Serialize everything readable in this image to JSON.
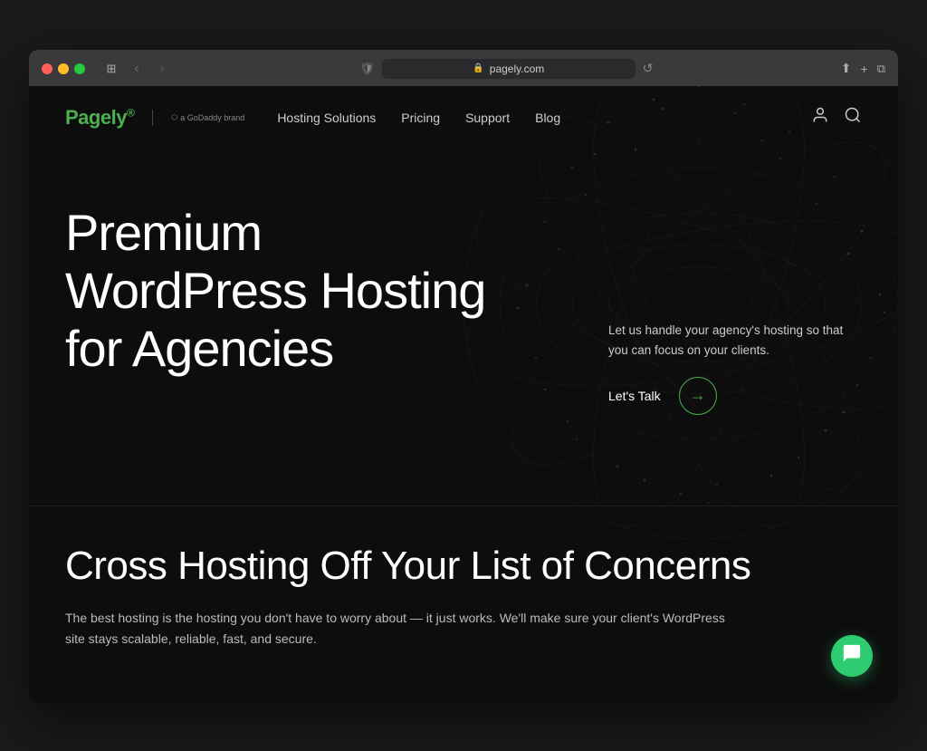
{
  "browser": {
    "url": "pagely.com",
    "refresh_icon": "↺",
    "back_icon": "‹",
    "forward_icon": "›",
    "sidebar_icon": "□",
    "share_icon": "⬆",
    "add_tab_icon": "+",
    "tabs_icon": "⧉"
  },
  "nav": {
    "logo_text": "Pagely",
    "logo_accent": "®",
    "godaddy_label": "a  GoDaddy brand",
    "links": [
      {
        "label": "Hosting Solutions",
        "id": "hosting-solutions"
      },
      {
        "label": "Pricing",
        "id": "pricing"
      },
      {
        "label": "Support",
        "id": "support"
      },
      {
        "label": "Blog",
        "id": "blog"
      }
    ],
    "user_icon": "person",
    "search_icon": "search"
  },
  "hero": {
    "title_line1": "Premium",
    "title_line2": "WordPress Hosting",
    "title_line3": "for Agencies",
    "subtitle": "Let us handle your agency's hosting so that you can focus on your clients.",
    "cta_label": "Let's Talk",
    "cta_arrow": "→"
  },
  "section_two": {
    "title": "Cross Hosting Off Your List of Concerns",
    "description": "The best hosting is the hosting you don't have to worry about — it just works. We'll make sure your client's WordPress site stays scalable, reliable, fast, and secure."
  },
  "chat": {
    "icon": "💬"
  },
  "colors": {
    "accent_green": "#2ecc71",
    "bg_dark": "#0d0d0d",
    "nav_bg": "#111111",
    "text_primary": "#ffffff",
    "text_secondary": "#cccccc"
  }
}
